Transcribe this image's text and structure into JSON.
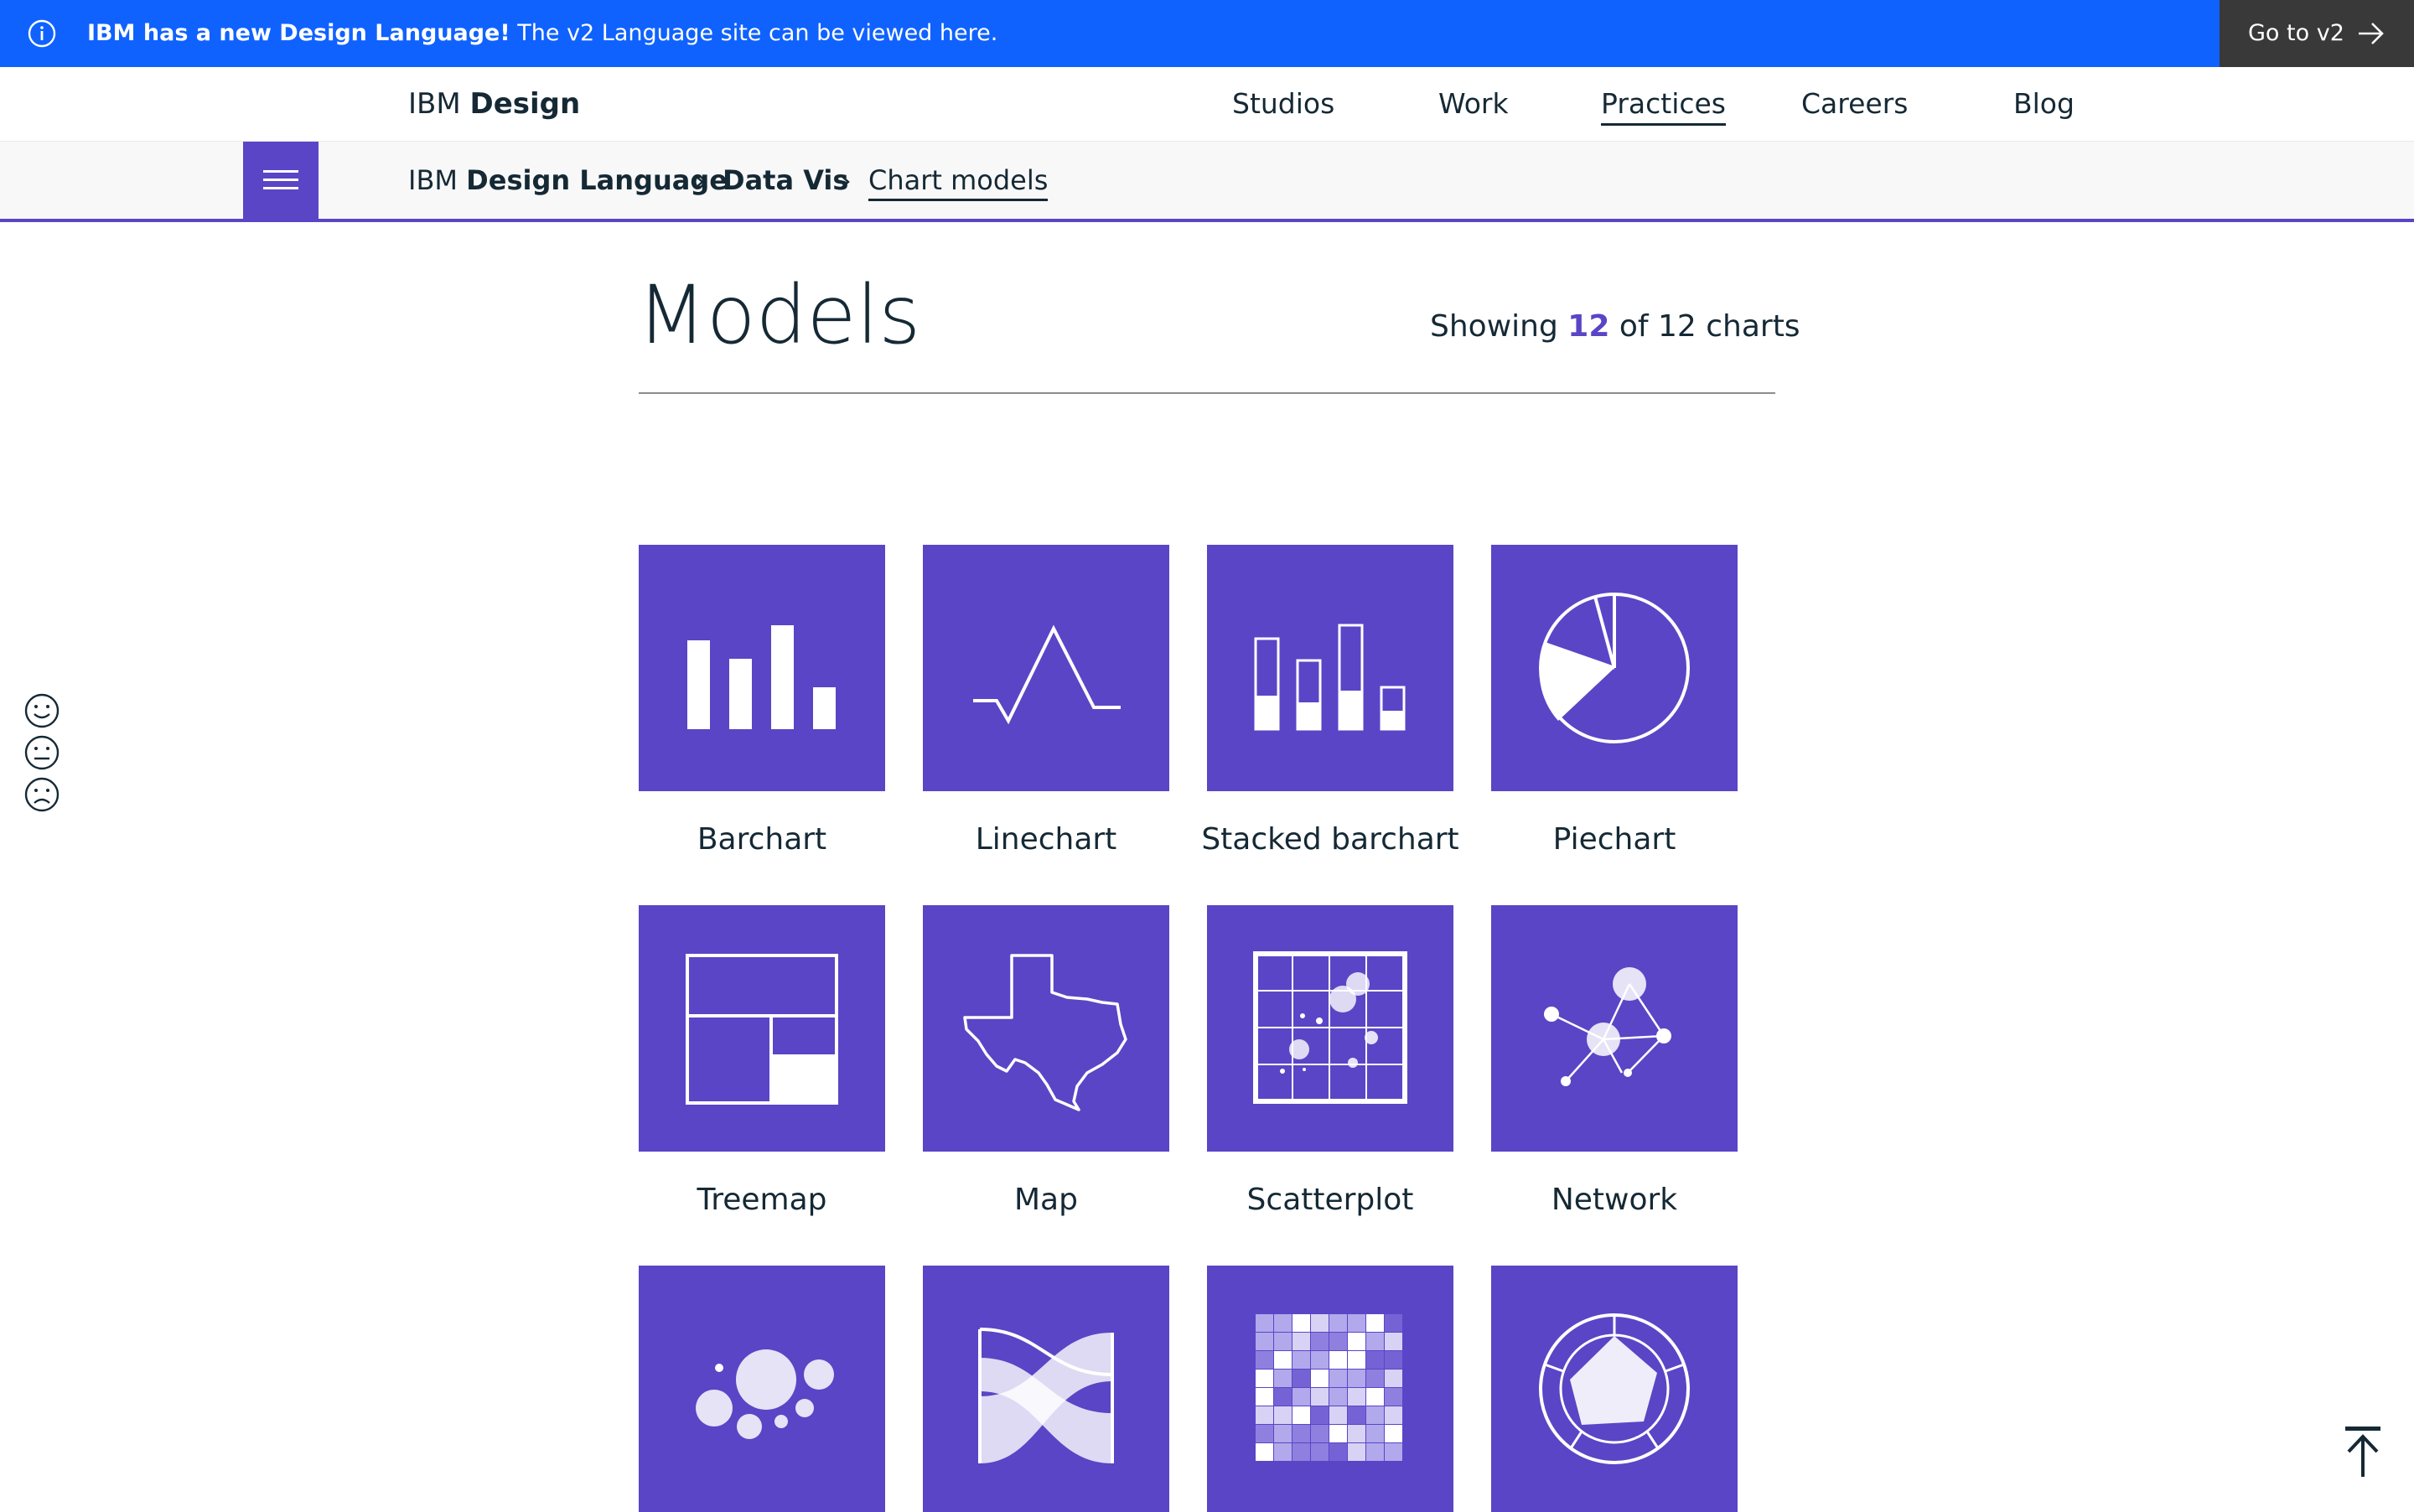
{
  "banner": {
    "headline": "IBM has a new Design Language!",
    "message": "The v2 Language site can be viewed here.",
    "cta_label": "Go to v2",
    "background": "#0f62fe",
    "cta_background": "#393939"
  },
  "nav": {
    "brand_prefix": "IBM",
    "brand_name": "Design",
    "links": [
      "Studios",
      "Work",
      "Practices",
      "Careers",
      "Blog"
    ],
    "active": "Practices"
  },
  "breadcrumb": {
    "root_prefix": "IBM",
    "root_name": "Design Language",
    "section": "Data Vis",
    "current": "Chart models"
  },
  "page": {
    "title": "Models",
    "showing_prefix": "Showing",
    "showing_count": "12",
    "showing_suffix": "of 12 charts",
    "accent": "#5a45c6"
  },
  "charts": [
    {
      "label": "Barchart",
      "icon": "barchart-icon"
    },
    {
      "label": "Linechart",
      "icon": "linechart-icon"
    },
    {
      "label": "Stacked barchart",
      "icon": "stacked-barchart-icon"
    },
    {
      "label": "Piechart",
      "icon": "piechart-icon"
    },
    {
      "label": "Treemap",
      "icon": "treemap-icon"
    },
    {
      "label": "Map",
      "icon": "map-icon"
    },
    {
      "label": "Scatterplot",
      "icon": "scatterplot-icon"
    },
    {
      "label": "Network",
      "icon": "network-icon"
    },
    {
      "label": "",
      "icon": "bubble-chart-icon"
    },
    {
      "label": "",
      "icon": "alluvial-icon"
    },
    {
      "label": "",
      "icon": "heatmap-icon"
    },
    {
      "label": "",
      "icon": "radar-chart-icon"
    }
  ],
  "feedback": [
    "smile-face-icon",
    "neutral-face-icon",
    "frown-face-icon"
  ]
}
